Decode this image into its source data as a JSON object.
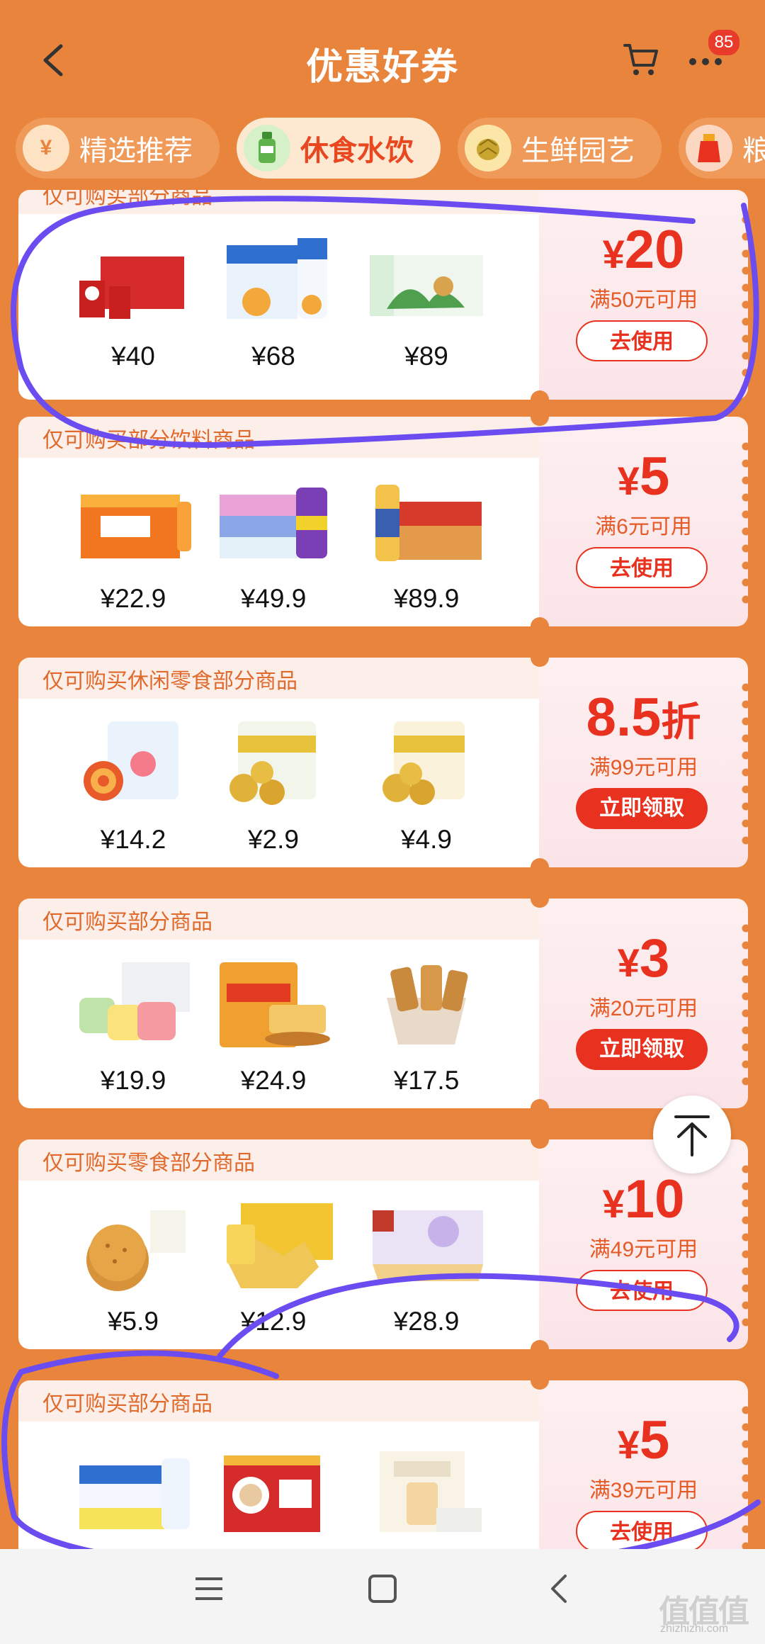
{
  "header": {
    "title": "优惠好券",
    "cart_badge": "85"
  },
  "tabs": [
    {
      "label": "精选推荐",
      "icon": "coupon-ticket-icon",
      "active": false
    },
    {
      "label": "休食水饮",
      "icon": "drink-bottle-icon",
      "active": true
    },
    {
      "label": "生鲜园艺",
      "icon": "durian-icon",
      "active": false
    },
    {
      "label": "粮",
      "icon": "grain-bag-icon",
      "active": false
    }
  ],
  "coupons": [
    {
      "condition": "仅可购买部分商品",
      "items": [
        {
          "price": "¥40"
        },
        {
          "price": "¥68"
        },
        {
          "price": "¥89"
        }
      ],
      "amount_prefix": "¥",
      "amount_value": "20",
      "amount_suffix": "",
      "threshold": "满50元可用",
      "action": "去使用",
      "action_style": "outline"
    },
    {
      "condition": "仅可购买部分饮料商品",
      "items": [
        {
          "price": "¥22.9"
        },
        {
          "price": "¥49.9"
        },
        {
          "price": "¥89.9"
        }
      ],
      "amount_prefix": "¥",
      "amount_value": "5",
      "amount_suffix": "",
      "threshold": "满6元可用",
      "action": "去使用",
      "action_style": "outline"
    },
    {
      "condition": "仅可购买休闲零食部分商品",
      "items": [
        {
          "price": "¥14.2"
        },
        {
          "price": "¥2.9"
        },
        {
          "price": "¥4.9"
        }
      ],
      "amount_prefix": "",
      "amount_value": "8.5",
      "amount_suffix": "折",
      "threshold": "满99元可用",
      "action": "立即领取",
      "action_style": "solid"
    },
    {
      "condition": "仅可购买部分商品",
      "items": [
        {
          "price": "¥19.9"
        },
        {
          "price": "¥24.9"
        },
        {
          "price": "¥17.5"
        }
      ],
      "amount_prefix": "¥",
      "amount_value": "3",
      "amount_suffix": "",
      "threshold": "满20元可用",
      "action": "立即领取",
      "action_style": "solid"
    },
    {
      "condition": "仅可购买零食部分商品",
      "items": [
        {
          "price": "¥5.9"
        },
        {
          "price": "¥12.9"
        },
        {
          "price": "¥28.9"
        }
      ],
      "amount_prefix": "¥",
      "amount_value": "10",
      "amount_suffix": "",
      "threshold": "满49元可用",
      "action": "去使用",
      "action_style": "outline"
    },
    {
      "condition": "仅可购买部分商品",
      "items": [
        {
          "price": ""
        },
        {
          "price": ""
        },
        {
          "price": ""
        }
      ],
      "amount_prefix": "¥",
      "amount_value": "5",
      "amount_suffix": "",
      "threshold": "满39元可用",
      "action": "去使用",
      "action_style": "outline"
    }
  ],
  "watermark": {
    "glyphs": "值值值",
    "url": "zhizhizhi.com"
  },
  "colors": {
    "page_background": "#e8843c",
    "accent_red": "#e8321f",
    "annotation_stroke": "#6a4cf0"
  }
}
